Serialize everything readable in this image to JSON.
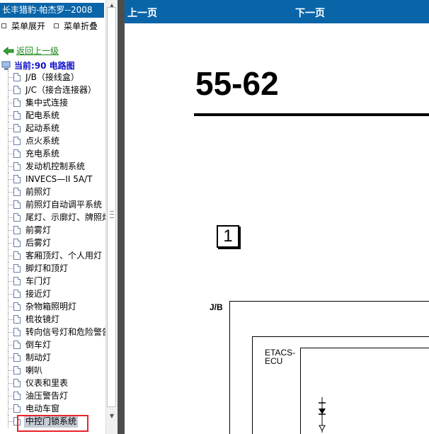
{
  "app": {
    "title": "长丰猎豹-帕杰罗--2008"
  },
  "menu": {
    "expand_label": "菜单展开",
    "collapse_label": "菜单折叠"
  },
  "tree": {
    "back_label": "返回上一级",
    "current_label": "当前:90 电路图",
    "items": [
      {
        "label": "J/B（接线盒）"
      },
      {
        "label": "J/C（接合连接器）"
      },
      {
        "label": "集中式连接"
      },
      {
        "label": "配电系统"
      },
      {
        "label": "起动系统"
      },
      {
        "label": "点火系统"
      },
      {
        "label": "充电系统"
      },
      {
        "label": "发动机控制系统"
      },
      {
        "label": "INVECS—II 5A/T"
      },
      {
        "label": "前照灯"
      },
      {
        "label": "前照灯自动调平系统"
      },
      {
        "label": "尾灯、示廓灯、牌照灯"
      },
      {
        "label": "前雾灯"
      },
      {
        "label": "后雾灯"
      },
      {
        "label": "客厢顶灯、个人用灯"
      },
      {
        "label": "脚灯和顶灯"
      },
      {
        "label": "车门灯"
      },
      {
        "label": "接近灯"
      },
      {
        "label": "杂物箱照明灯"
      },
      {
        "label": "梳妆镜灯"
      },
      {
        "label": "转向信号灯和危险警告灯"
      },
      {
        "label": "倒车灯"
      },
      {
        "label": "制动灯"
      },
      {
        "label": "喇叭"
      },
      {
        "label": "仪表和里表"
      },
      {
        "label": "油压警告灯"
      },
      {
        "label": "电动车窗"
      },
      {
        "label": "中控门锁系统"
      }
    ],
    "selected_index": 27
  },
  "nav": {
    "prev_label": "上一页",
    "next_label": "下一页"
  },
  "document": {
    "page_number": "55-62",
    "box_number": "1",
    "jb_label": "J/B",
    "etacs_label_line1": "ETACS-",
    "etacs_label_line2": "ECU"
  },
  "colors": {
    "title_bar": "#0a65a8",
    "highlight_box": "#e8242a",
    "back_link": "#1a8a1a",
    "current_node": "#1010c8"
  }
}
